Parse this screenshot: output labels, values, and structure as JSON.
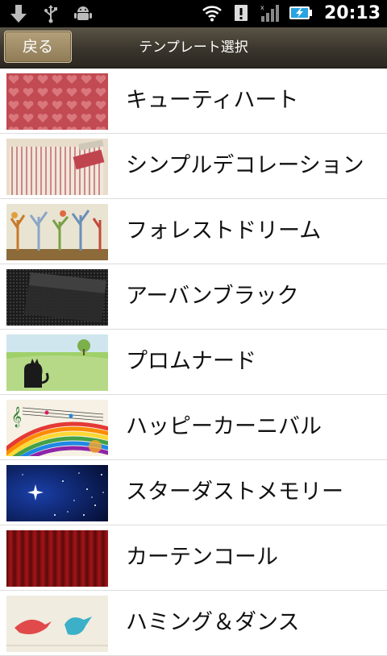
{
  "status_bar": {
    "time": "20:13",
    "icons": [
      "download-icon",
      "usb-icon",
      "android-debug-icon",
      "wifi-icon",
      "alert-icon",
      "signal-icon",
      "battery-charging-icon"
    ]
  },
  "header": {
    "back_label": "戻る",
    "title": "テンプレート選択"
  },
  "templates": [
    {
      "label": "キューティハート",
      "thumbnail": "hearts-pattern"
    },
    {
      "label": "シンプルデコレーション",
      "thumbnail": "striped-paper"
    },
    {
      "label": "フォレストドリーム",
      "thumbnail": "forest-trees"
    },
    {
      "label": "アーバンブラック",
      "thumbnail": "black-mesh"
    },
    {
      "label": "プロムナード",
      "thumbnail": "cat-meadow"
    },
    {
      "label": "ハッピーカーニバル",
      "thumbnail": "rainbow-music"
    },
    {
      "label": "スターダストメモリー",
      "thumbnail": "starry-night"
    },
    {
      "label": "カーテンコール",
      "thumbnail": "red-curtain"
    },
    {
      "label": "ハミング＆ダンス",
      "thumbnail": "birds"
    }
  ],
  "colors": {
    "status_bar": "#000000",
    "title_bar": "#3a352c",
    "back_button": "#a08e69",
    "divider": "#dcdcdc"
  }
}
